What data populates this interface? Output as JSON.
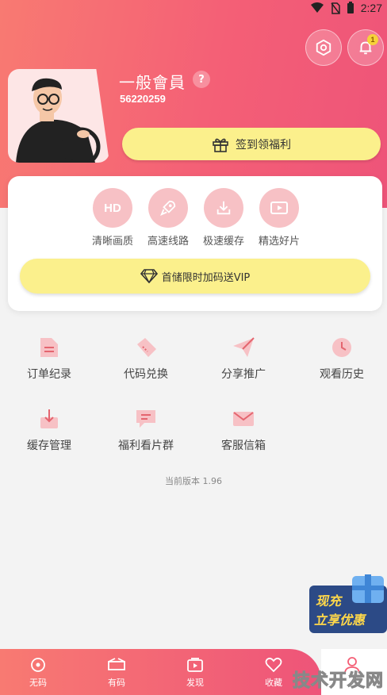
{
  "status_bar": {
    "time": "2:27"
  },
  "header": {
    "user_name": "一般會員",
    "help_mark": "?",
    "user_id": "56220259",
    "notification_count": "1",
    "signin_label": "签到领福利"
  },
  "features": [
    {
      "label": "清晰画质",
      "icon_text": "HD",
      "icon": "hd-icon"
    },
    {
      "label": "高速线路",
      "icon_text": "",
      "icon": "rocket-icon"
    },
    {
      "label": "极速缓存",
      "icon_text": "",
      "icon": "download-icon"
    },
    {
      "label": "精选好片",
      "icon_text": "",
      "icon": "play-icon"
    }
  ],
  "vip_button": {
    "label": "首储限时加码送VIP"
  },
  "menu": [
    {
      "label": "订单纪录",
      "icon": "document-icon"
    },
    {
      "label": "代码兑换",
      "icon": "ticket-icon"
    },
    {
      "label": "分享推广",
      "icon": "paper-plane-icon"
    },
    {
      "label": "观看历史",
      "icon": "clock-icon"
    },
    {
      "label": "缓存管理",
      "icon": "download-icon"
    },
    {
      "label": "福利看片群",
      "icon": "chat-icon"
    },
    {
      "label": "客服信箱",
      "icon": "mail-icon"
    }
  ],
  "version": "当前版本 1.96",
  "promo": {
    "line1": "现充",
    "line2": "立享优惠"
  },
  "tabs": [
    {
      "label": "无码",
      "icon": "disc-icon"
    },
    {
      "label": "有码",
      "icon": "film-icon"
    },
    {
      "label": "发现",
      "icon": "video-icon"
    },
    {
      "label": "收藏",
      "icon": "heart-icon"
    }
  ],
  "watermark": "技术开发网",
  "colors": {
    "accent": "#f45f76",
    "button_yellow": "#fbf08c",
    "icon_pink": "#f7c1c5"
  }
}
